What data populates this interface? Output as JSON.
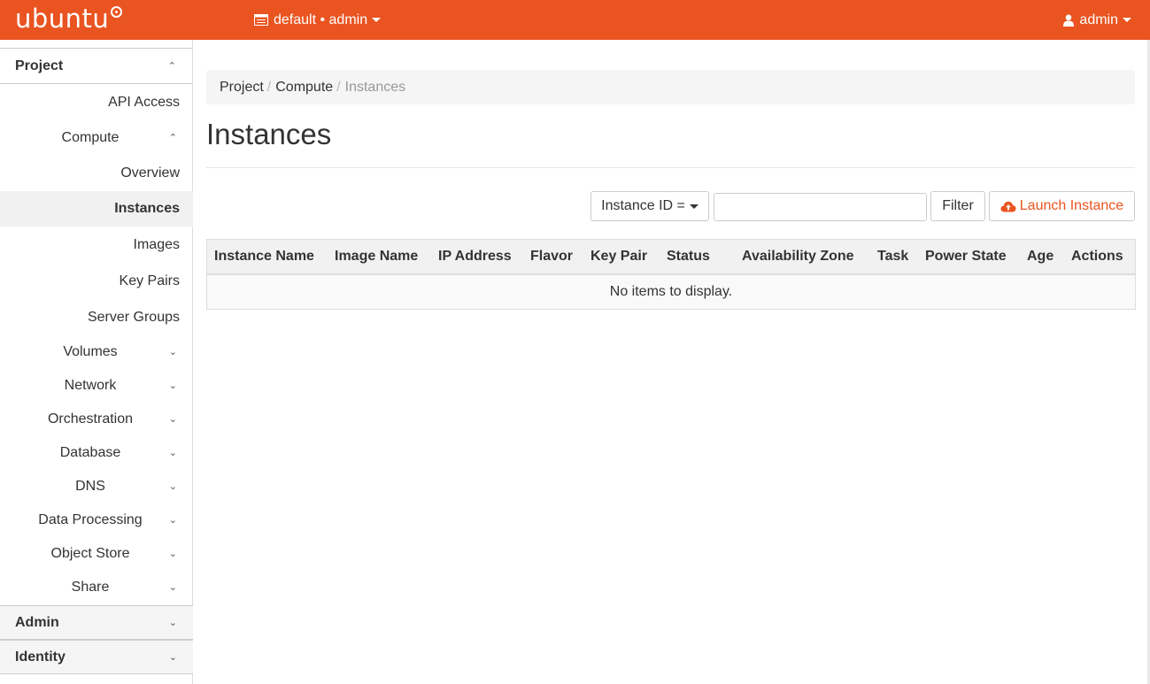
{
  "topbar": {
    "brand": "ubuntu",
    "project_label": "default • admin",
    "user_label": "admin",
    "bg_color": "#e95420"
  },
  "sidebar": {
    "sections": [
      {
        "label": "Project",
        "expanded": true
      },
      {
        "label": "Admin",
        "expanded": false
      },
      {
        "label": "Identity",
        "expanded": false
      }
    ],
    "items": [
      {
        "label": "API Access"
      },
      {
        "label": "Compute",
        "expanded": true
      },
      {
        "label": "Overview"
      },
      {
        "label": "Instances",
        "active": true
      },
      {
        "label": "Images"
      },
      {
        "label": "Key Pairs"
      },
      {
        "label": "Server Groups"
      },
      {
        "label": "Volumes"
      },
      {
        "label": "Network"
      },
      {
        "label": "Orchestration"
      },
      {
        "label": "Database"
      },
      {
        "label": "DNS"
      },
      {
        "label": "Data Processing"
      },
      {
        "label": "Object Store"
      },
      {
        "label": "Share"
      }
    ]
  },
  "breadcrumb": [
    "Project",
    "Compute",
    "Instances"
  ],
  "page_title": "Instances",
  "toolbar": {
    "filter_field": "Instance ID =",
    "filter_value": "",
    "filter_button": "Filter",
    "launch_button": "Launch Instance"
  },
  "table": {
    "columns": [
      "Instance Name",
      "Image Name",
      "IP Address",
      "Flavor",
      "Key Pair",
      "Status",
      "Availability Zone",
      "Task",
      "Power State",
      "Age",
      "Actions"
    ],
    "empty_message": "No items to display."
  }
}
